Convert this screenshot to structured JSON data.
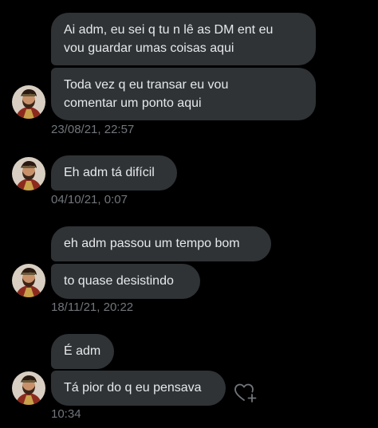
{
  "conversation": {
    "groups": [
      {
        "messages": [
          "Ai adm, eu sei q tu n lê as DM ent eu\nvou guardar umas coisas aqui",
          "Toda vez q eu transar eu vou\ncomentar um ponto aqui"
        ],
        "timestamp": "23/08/21, 22:57"
      },
      {
        "messages": [
          "Eh adm tá difícil"
        ],
        "timestamp": "04/10/21, 0:07"
      },
      {
        "messages": [
          "eh adm passou um tempo bom",
          "to quase desistindo"
        ],
        "timestamp": "18/11/21, 20:22"
      },
      {
        "messages": [
          "É adm",
          "Tá pior do q eu pensava"
        ],
        "timestamp": "10:34"
      }
    ]
  },
  "icons": {
    "avatar": "user-avatar",
    "react": "heart-plus-icon"
  },
  "colors": {
    "background": "#000000",
    "bubble": "#2f3336",
    "text": "#e7e9ea",
    "timestamp": "#71767b"
  }
}
